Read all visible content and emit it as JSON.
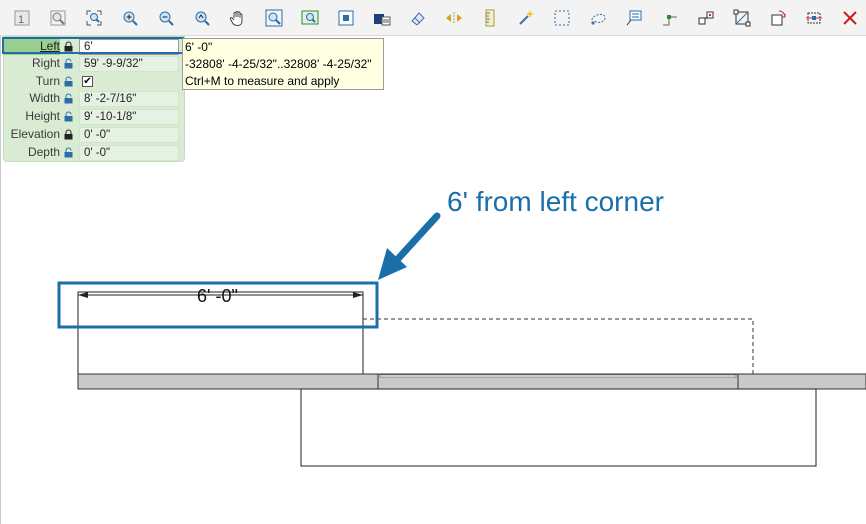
{
  "toolbar": {
    "icons": [
      "level-icon",
      "zoom-region-icon",
      "zoom-extents-icon",
      "zoom-in-icon",
      "zoom-out-icon",
      "zoom-previous-icon",
      "pan-hand-icon",
      "zoom-window-icon",
      "zoom-fit-icon",
      "select-box-icon",
      "bring-front-icon",
      "eraser-icon",
      "swap-icon",
      "ruler-icon",
      "magic-wand-icon",
      "select-region-icon",
      "lasso-icon",
      "annotate-icon",
      "node-icon",
      "group-icon",
      "transform-icon",
      "rotate-icon",
      "distribute-icon",
      "close-icon"
    ],
    "close_color": "#cc1f1f"
  },
  "properties": {
    "rows": [
      {
        "label": "Left",
        "value": "6'",
        "locked": true
      },
      {
        "label": "Right",
        "value": "59' -9-9/32\"",
        "locked": false
      },
      {
        "label": "Turn",
        "value": "",
        "checked": true,
        "locked": false
      },
      {
        "label": "Width",
        "value": "8' -2-7/16\"",
        "locked": false
      },
      {
        "label": "Height",
        "value": "9' -10-1/8\"",
        "locked": false
      },
      {
        "label": "Elevation",
        "value": "0' -0\"",
        "locked": true
      },
      {
        "label": "Depth",
        "value": "0' -0\"",
        "locked": false
      }
    ],
    "check_mark": "✔"
  },
  "tooltip": {
    "line1": "6' -0\"",
    "line2": "-32808' -4-25/32\"..32808' -4-25/32\"",
    "line3": "Ctrl+M to measure and apply"
  },
  "annotation": {
    "text": "6' from left corner",
    "color": "#1b6fa8"
  },
  "dimension": {
    "text": "6' -0\""
  }
}
